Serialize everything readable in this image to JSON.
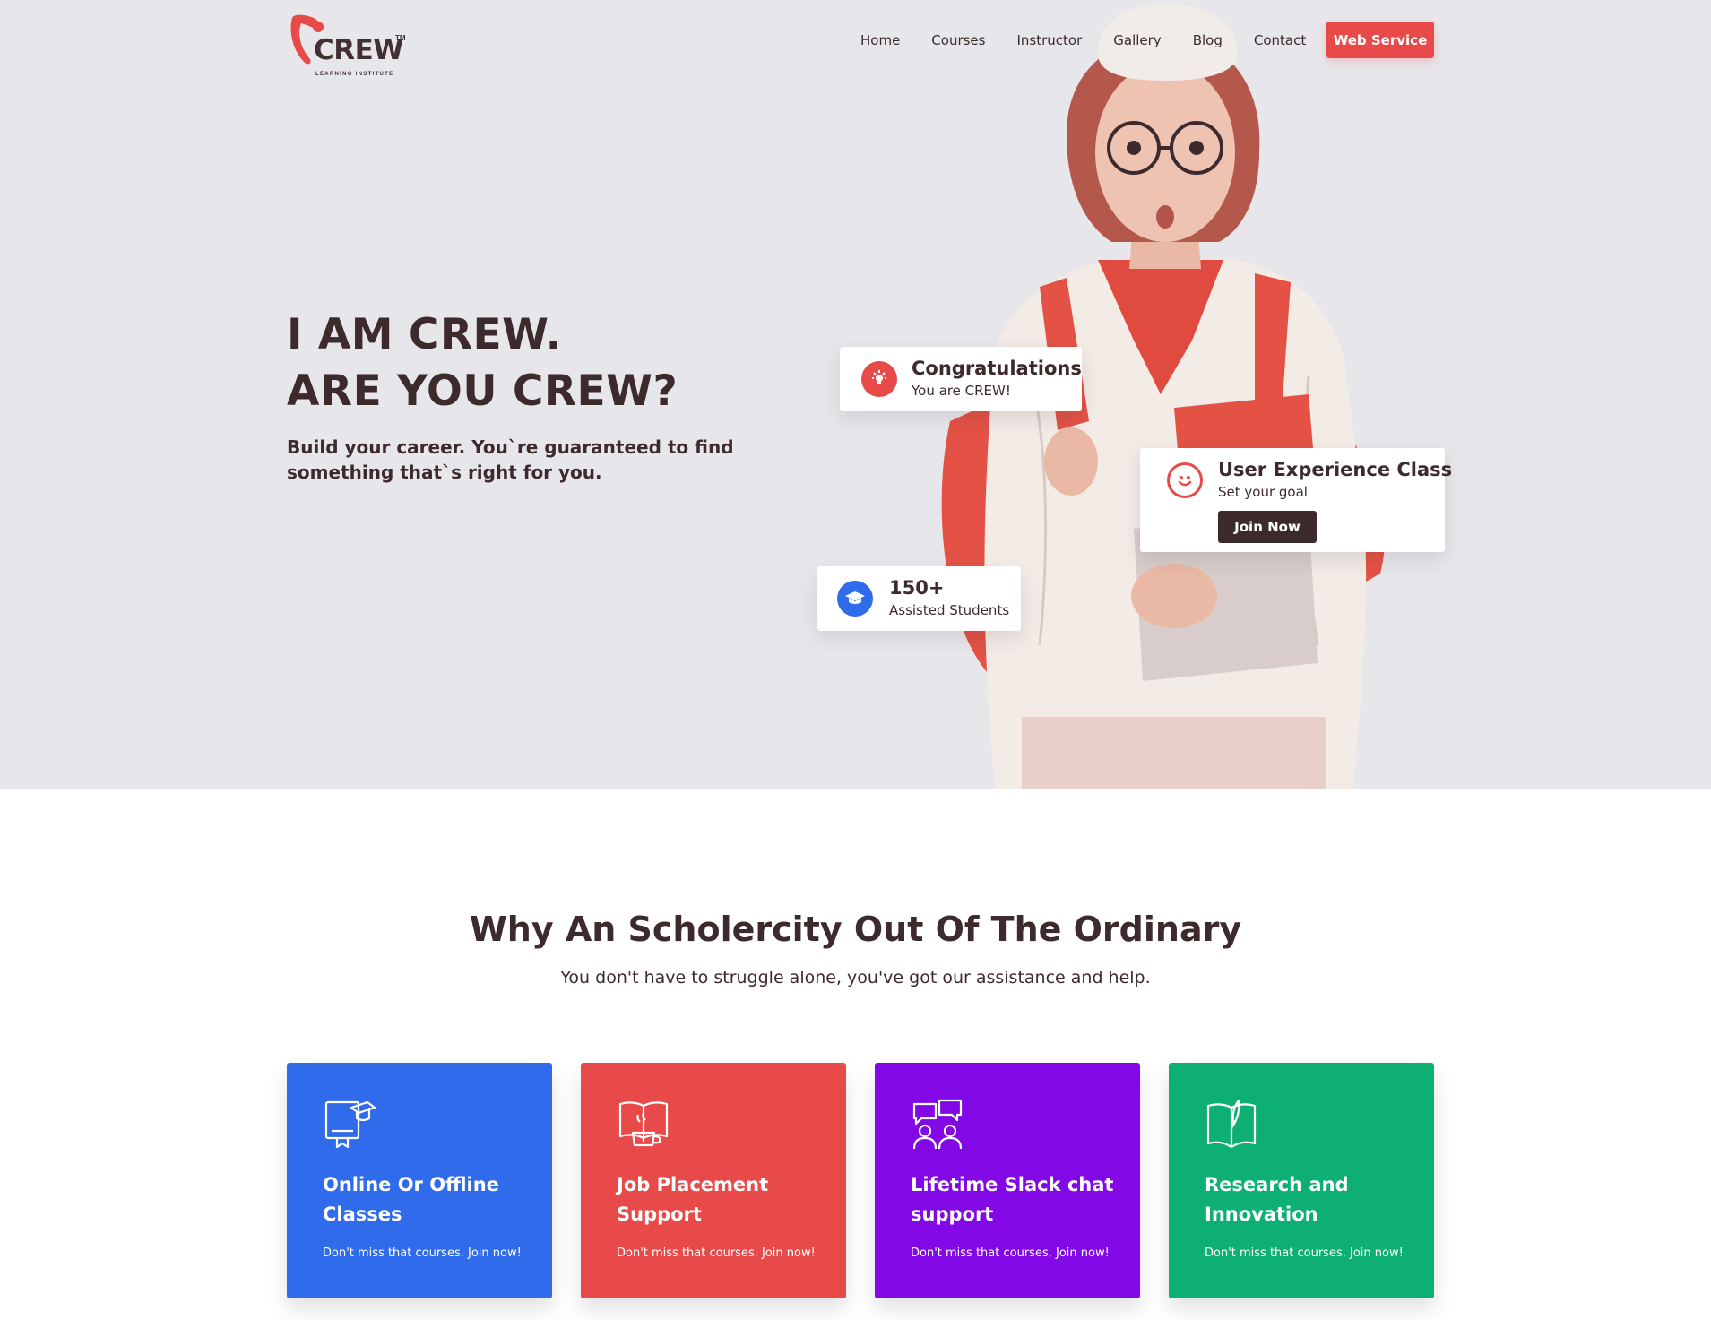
{
  "brand": {
    "name": "CREW",
    "trademark": "TM",
    "tagline": "LEARNING INSTITUTE",
    "accent": "#e84a4a",
    "dark": "#3d2a2d"
  },
  "nav": {
    "items": [
      {
        "label": "Home"
      },
      {
        "label": "Courses"
      },
      {
        "label": "Instructor"
      },
      {
        "label": "Gallery"
      },
      {
        "label": "Blog"
      },
      {
        "label": "Contact"
      }
    ],
    "cta_label": "Web Service"
  },
  "hero": {
    "title_line1": "I AM CREW.",
    "title_line2": "ARE YOU CREW?",
    "subtitle": "Build your career. You`re guaranteed to find something that`s right for you.",
    "cards": {
      "congrats": {
        "title": "Congratulations",
        "subtitle": "You are CREW!",
        "icon": "lightbulb-icon"
      },
      "ux_class": {
        "title": "User Experience Class",
        "subtitle": "Set your goal",
        "button": "Join Now",
        "icon": "smile-icon"
      },
      "students": {
        "title": "150+",
        "subtitle": "Assisted Students",
        "icon": "graduation-cap-icon"
      }
    }
  },
  "why": {
    "title": "Why An Scholercity Out Of The Ordinary",
    "subtitle": "You don't have to struggle alone, you've got our assistance and help.",
    "features": [
      {
        "title": "Online Or Offline Classes",
        "desc": "Don't miss that courses, Join now!",
        "color": "#2f6bea",
        "icon": "certificate-icon"
      },
      {
        "title": "Job Placement Support",
        "desc": "Don't miss that courses, Join now!",
        "color": "#e84a4a",
        "icon": "book-coffee-icon"
      },
      {
        "title": "Lifetime Slack chat support",
        "desc": "Don't miss that courses, Join now!",
        "color": "#8209e6",
        "icon": "chat-people-icon"
      },
      {
        "title": "Research and Innovation",
        "desc": "Don't miss that courses, Join now!",
        "color": "#0db072",
        "icon": "book-quill-icon"
      }
    ]
  }
}
